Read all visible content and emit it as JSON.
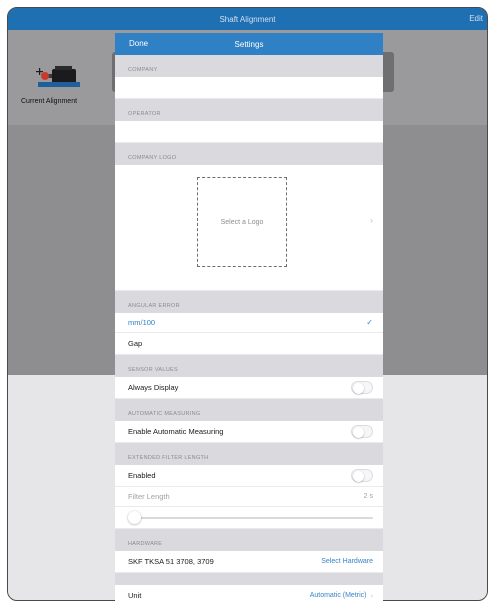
{
  "app": {
    "title": "Shaft Alignment",
    "edit_label": "Edit",
    "current_alignment_label": "Current Alignment"
  },
  "settings": {
    "title": "Settings",
    "done_label": "Done",
    "sections": {
      "company": "COMPANY",
      "operator": "OPERATOR",
      "company_logo": "COMPANY LOGO",
      "angular_error": "ANGULAR ERROR",
      "sensor_values": "SENSOR VALUES",
      "automatic_measuring": "AUTOMATIC MEASURING",
      "extended_filter_length": "EXTENDED FILTER LENGTH",
      "hardware": "HARDWARE"
    },
    "company_value": "",
    "operator_value": "",
    "logo_placeholder": "Select a Logo",
    "angular_options": [
      {
        "label": "mm/100",
        "selected": true
      },
      {
        "label": "Gap",
        "selected": false
      }
    ],
    "always_display_label": "Always Display",
    "always_display_on": false,
    "enable_auto_label": "Enable Automatic Measuring",
    "enable_auto_on": false,
    "enabled_label": "Enabled",
    "enabled_on": false,
    "filter_length_label": "Filter Length",
    "filter_length_value": "2 s",
    "filter_length_slider_fraction": 0.0,
    "hardware_label": "SKF TKSA 51 3708, 3709",
    "select_hardware_label": "Select Hardware",
    "unit_label": "Unit",
    "unit_value": "Automatic (Metric)"
  },
  "colors": {
    "accent": "#2f80c4",
    "nav_bar": "#1f6fb3"
  },
  "icons": {
    "checkmark": "checkmark-icon",
    "chevron": "chevron-right-icon",
    "machine": "shaft-machine-icon"
  }
}
